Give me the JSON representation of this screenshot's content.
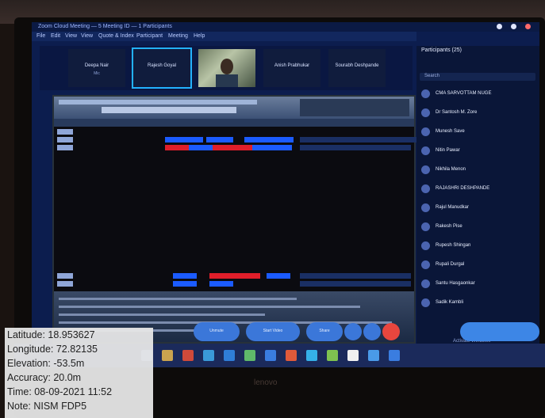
{
  "screen": {
    "title_text": "Zoom Cloud Meeting — 5 Meeting ID — 1 Participants",
    "menu": [
      "File",
      "Edit",
      "View",
      "View",
      "Quote & Index",
      "Participant",
      "Meeting",
      "Help"
    ]
  },
  "video_tiles": [
    {
      "label": "Deepa Nair",
      "sub": "Mic"
    },
    {
      "label": "Rajesh Goyal",
      "sub": ""
    },
    {
      "label": "",
      "sub": ""
    },
    {
      "label": "Anish Prabhukar",
      "sub": ""
    },
    {
      "label": "Sourabh Deshpande",
      "sub": ""
    }
  ],
  "participants": {
    "title": "Participants (25)",
    "search_placeholder": "Search",
    "items": [
      "CMA SARVOTTAM NUGE",
      "Dr Santosh M. Zore",
      "Munesh Save",
      "Nitin Pawar",
      "Nikhila Menon",
      "RAJASHRI DESHPANDE",
      "Rajul Manudkar",
      "Rakesh Pise",
      "Rupesh Shingan",
      "Rupali Durgal",
      "Santu Hasgaonkar",
      "Sadik Kambli"
    ],
    "hint": "Activate Windows"
  },
  "controls": [
    "Unmute",
    "Start Video",
    "Share"
  ],
  "overlay": {
    "latitude": "Latitude: 18.953627",
    "longitude": "Longitude: 72.82135",
    "elevation": "Elevation: -53.5m",
    "accuracy": "Accuracy: 20.0m",
    "time": "Time: 08-09-2021 11:52",
    "note": "Note: NISM FDP5"
  },
  "brand": "lenovo",
  "colors": {
    "zoom_blue": "#3b77d9",
    "red_button": "#e8463e",
    "bar_blue": "#1b5bff",
    "bar_red": "#e01e2a"
  }
}
